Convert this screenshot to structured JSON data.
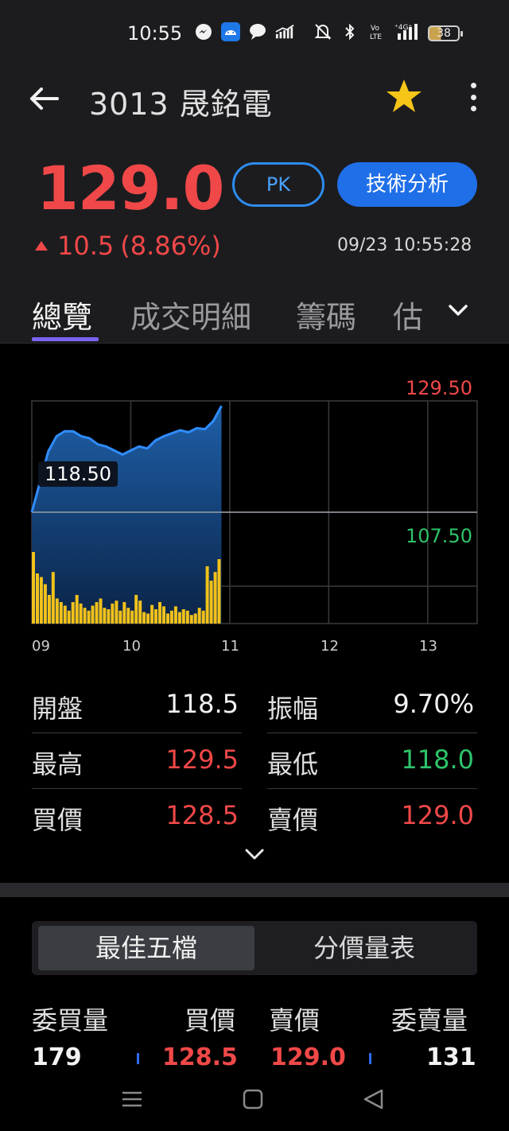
{
  "status_bar": {
    "time": "10:55",
    "battery": "38",
    "icons": [
      "messenger-icon",
      "android-icon",
      "chat-icon",
      "signal-chart-icon",
      "mute-icon",
      "bluetooth-icon",
      "volte-icon",
      "4g-signal-icon",
      "battery-icon"
    ]
  },
  "header": {
    "title": "3013 晟銘電",
    "back_icon": "back-arrow-icon",
    "favorite_icon": "star-icon",
    "favorite_color": "#f5c518",
    "more_icon": "more-vertical-icon"
  },
  "quote": {
    "price": "129.0",
    "change": "10.5",
    "change_pct": "(8.86%)",
    "timestamp": "09/23 10:55:28",
    "pk_label": "PK",
    "technical_label": "技術分析",
    "up_color": "#f04848",
    "down_color": "#2ec36a"
  },
  "tabs": [
    {
      "label": "總覽",
      "active": true
    },
    {
      "label": "成交明細",
      "active": false
    },
    {
      "label": "籌碼",
      "active": false
    },
    {
      "label": "估",
      "active": false
    }
  ],
  "chart_data": {
    "type": "area",
    "title": "",
    "xlabel": "",
    "ylabel": "",
    "x_ticks": [
      "09",
      "10",
      "11",
      "12",
      "13"
    ],
    "ylim": [
      107.5,
      129.5
    ],
    "y_labels": {
      "high": "129.50",
      "ref": "118.50",
      "low": "107.50"
    },
    "reference_price": 118.5,
    "grid": true,
    "series": [
      {
        "x": [
          "09:00",
          "09:05",
          "09:10",
          "09:15",
          "09:20",
          "09:25",
          "09:30",
          "09:35",
          "09:40",
          "09:45",
          "09:50",
          "09:55",
          "10:00",
          "10:05",
          "10:10",
          "10:15",
          "10:20",
          "10:25",
          "10:30",
          "10:35",
          "10:40",
          "10:45",
          "10:50",
          "10:55"
        ],
        "values": [
          118.5,
          121.5,
          124.5,
          126.0,
          126.5,
          126.5,
          126.0,
          125.8,
          125.2,
          125.0,
          124.6,
          124.2,
          124.6,
          125.0,
          124.8,
          125.6,
          126.0,
          126.3,
          126.6,
          126.4,
          126.8,
          126.7,
          127.5,
          129.0
        ]
      }
    ],
    "volume": [
      100,
      70,
      65,
      55,
      40,
      72,
      35,
      30,
      25,
      18,
      30,
      40,
      28,
      22,
      18,
      25,
      30,
      35,
      22,
      20,
      28,
      32,
      18,
      30,
      22,
      18,
      40,
      32,
      16,
      14,
      26,
      20,
      30,
      24,
      14,
      18,
      24,
      16,
      20,
      18,
      12,
      14,
      22,
      18,
      80,
      60,
      72,
      90
    ]
  },
  "stats": [
    {
      "label": "開盤",
      "value": "118.5",
      "color": "#f2f2f2"
    },
    {
      "label": "振幅",
      "value": "9.70%",
      "color": "#f2f2f2"
    },
    {
      "label": "最高",
      "value": "129.5",
      "color": "#f04848"
    },
    {
      "label": "最低",
      "value": "118.0",
      "color": "#2ec36a"
    },
    {
      "label": "買價",
      "value": "128.5",
      "color": "#f04848"
    },
    {
      "label": "賣價",
      "value": "129.0",
      "color": "#f04848"
    }
  ],
  "orderbook": {
    "tab_active": "最佳五檔",
    "tab_inactive": "分價量表",
    "headers": [
      "委買量",
      "買價",
      "賣價",
      "委賣量"
    ],
    "first_row": [
      "179",
      "128.5",
      "129.0",
      "131"
    ]
  }
}
